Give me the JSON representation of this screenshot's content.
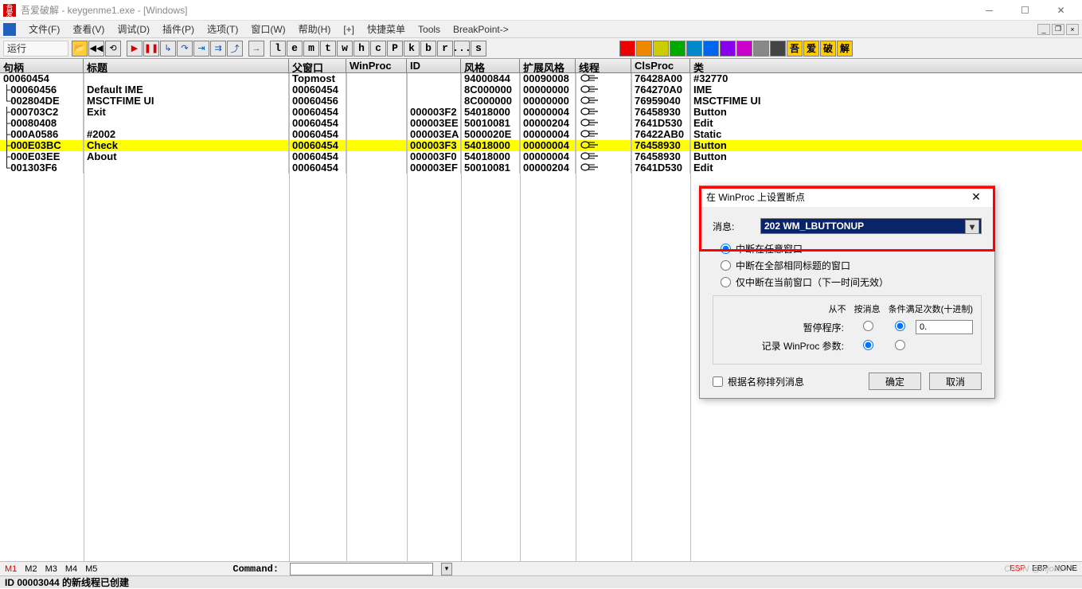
{
  "title": "吾爱破解 - keygenme1.exe - [Windows]",
  "menu": [
    "文件(F)",
    "查看(V)",
    "调试(D)",
    "插件(P)",
    "选项(T)",
    "窗口(W)",
    "帮助(H)",
    "[+]",
    "快捷菜单",
    "Tools",
    "BreakPoint->"
  ],
  "status": "运行",
  "letters": [
    "l",
    "e",
    "m",
    "t",
    "w",
    "h",
    "c",
    "P",
    "k",
    "b",
    "r",
    "...",
    "s"
  ],
  "cn_btns": [
    "吾",
    "爱",
    "破",
    "解"
  ],
  "headers": [
    "句柄",
    "标题",
    "父窗口",
    "WinProc",
    "ID",
    "风格",
    "扩展风格",
    "线程",
    "ClsProc",
    "类"
  ],
  "rows": [
    {
      "h": "00060454",
      "t": "",
      "p": "Topmost",
      "w": "",
      "id": "",
      "s": "94000844",
      "e": "00090008",
      "th": "",
      "c": "76428A00",
      "cl": "#32770",
      "lvl": 0
    },
    {
      "h": "00060456",
      "t": "Default IME",
      "p": "00060454",
      "w": "",
      "id": "",
      "s": "8C000000",
      "e": "00000000",
      "th": "",
      "c": "764270A0",
      "cl": "IME",
      "lvl": 1
    },
    {
      "h": "002804DE",
      "t": "MSCTFIME UI",
      "p": "00060456",
      "w": "",
      "id": "",
      "s": "8C000000",
      "e": "00000000",
      "th": "",
      "c": "76959040",
      "cl": "MSCTFIME UI",
      "lvl": 2
    },
    {
      "h": "000703C2",
      "t": "Exit",
      "p": "00060454",
      "w": "",
      "id": "000003F2",
      "s": "54018000",
      "e": "00000004",
      "th": "",
      "c": "76458930",
      "cl": "Button",
      "lvl": 1
    },
    {
      "h": "00080408",
      "t": "",
      "p": "00060454",
      "w": "",
      "id": "000003EE",
      "s": "50010081",
      "e": "00000204",
      "th": "",
      "c": "7641D530",
      "cl": "Edit",
      "lvl": 1
    },
    {
      "h": "000A0586",
      "t": "#2002",
      "p": "00060454",
      "w": "",
      "id": "000003EA",
      "s": "5000020E",
      "e": "00000004",
      "th": "",
      "c": "76422AB0",
      "cl": "Static",
      "lvl": 1
    },
    {
      "h": "000E03BC",
      "t": "Check",
      "p": "00060454",
      "w": "",
      "id": "000003F3",
      "s": "54018000",
      "e": "00000004",
      "th": "",
      "c": "76458930",
      "cl": "Button",
      "lvl": 1,
      "sel": true
    },
    {
      "h": "000E03EE",
      "t": "About",
      "p": "00060454",
      "w": "",
      "id": "000003F0",
      "s": "54018000",
      "e": "00000004",
      "th": "",
      "c": "76458930",
      "cl": "Button",
      "lvl": 1
    },
    {
      "h": "001303F6",
      "t": "",
      "p": "00060454",
      "w": "",
      "id": "000003EF",
      "s": "50010081",
      "e": "00000204",
      "th": "",
      "c": "7641D530",
      "cl": "Edit",
      "lvl": 2
    }
  ],
  "dialog": {
    "title": "在 WinProc 上设置断点",
    "msg_label": "消息:",
    "msg_value": "202 WM_LBUTTONUP",
    "radio1": "中断在任意窗口",
    "radio2": "中断在全部相同标题的窗口",
    "radio3": "仅中断在当前窗口（下一时间无效）",
    "col_never": "从不",
    "col_onmsg": "按消息",
    "col_count": "条件满足次数(十进制)",
    "row_pause": "暂停程序:",
    "row_log": "记录 WinProc 参数:",
    "count_val": "0.",
    "chk_sort": "根据名称排列消息",
    "ok": "确定",
    "cancel": "取消"
  },
  "bottom": {
    "markers": [
      "M1",
      "M2",
      "M3",
      "M4",
      "M5"
    ],
    "cmd_label": "Command:",
    "flags": [
      "ESP",
      "EBP",
      "NONE"
    ],
    "status": "ID 00003044 的新线程已创建"
  },
  "watermark": "CSDN @injoker"
}
